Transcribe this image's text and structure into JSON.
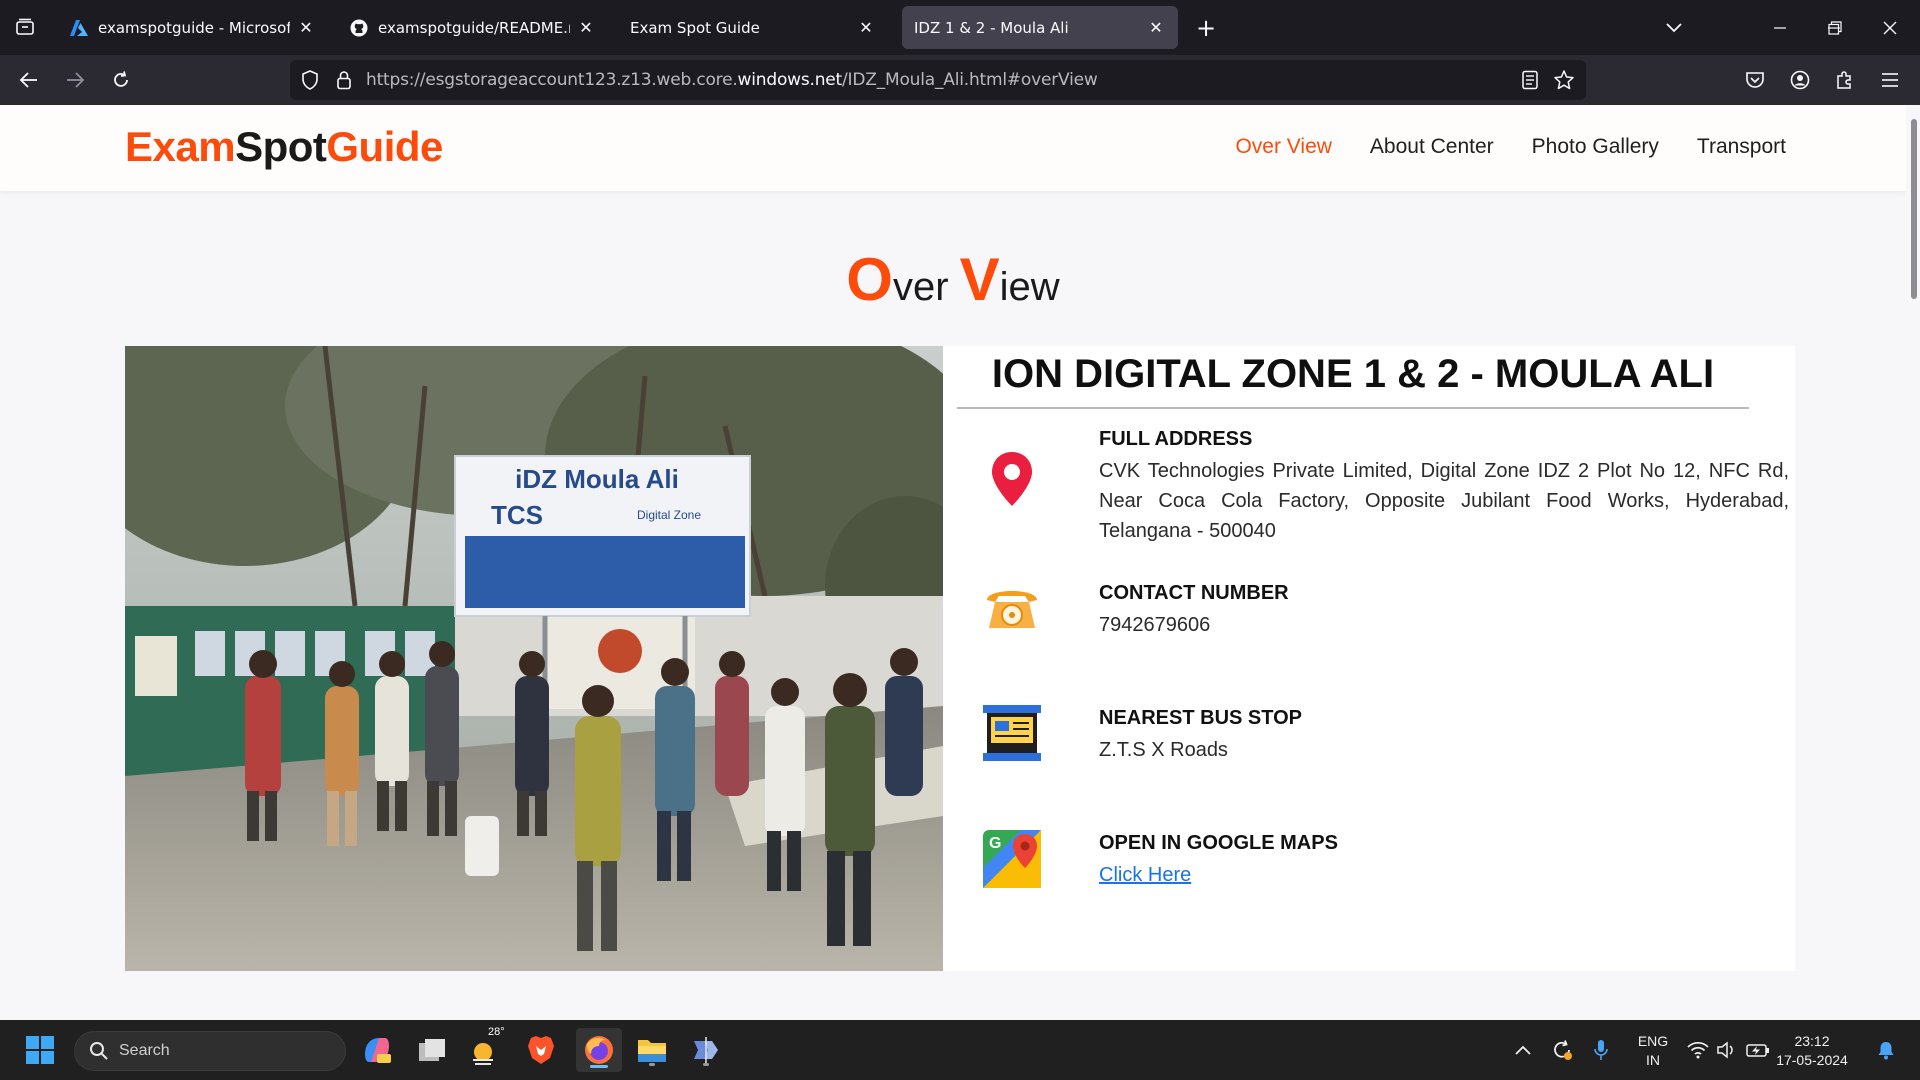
{
  "browser": {
    "tabs": [
      {
        "title": "examspotguide - Microsoft Azu",
        "favicon": "azure-icon",
        "active": false
      },
      {
        "title": "examspotguide/README.md at",
        "favicon": "github-icon",
        "active": false
      },
      {
        "title": "Exam Spot Guide",
        "favicon": "",
        "active": false
      },
      {
        "title": "IDZ 1 & 2 - Moula Ali",
        "favicon": "",
        "active": true
      }
    ],
    "url_prefix": "https://esgstorageaccount123.z13.web.core.",
    "url_host": "windows.net",
    "url_path": "/IDZ_Moula_Ali.html#overView"
  },
  "site": {
    "logo_part1": "Exam",
    "logo_part2": "Spot",
    "logo_part3": "Guide",
    "menu": [
      {
        "label": "Over View",
        "active": true
      },
      {
        "label": "About Center",
        "active": false
      },
      {
        "label": "Photo Gallery",
        "active": false
      },
      {
        "label": "Transport",
        "active": false
      }
    ],
    "section_title": {
      "o": "O",
      "ver": "ver ",
      "v": "V",
      "iew": "iew"
    },
    "center_name": "ION DIGITAL ZONE 1 & 2 - MOULA ALI",
    "photo": {
      "sign_title": "iDZ Moula Ali",
      "sign_brand": "TCS",
      "sign_sub": "Digital Zone"
    },
    "info": [
      {
        "label": "FULL ADDRESS",
        "value": "CVK Technologies Private Limited, Digital Zone IDZ 2 Plot No 12, NFC Rd, Near Coca Cola Factory, Opposite Jubilant Food Works, Hyderabad, Telangana - 500040",
        "icon": "location-pin-icon"
      },
      {
        "label": "CONTACT NUMBER",
        "value": "7942679606",
        "icon": "telephone-icon"
      },
      {
        "label": "NEAREST BUS STOP",
        "value": "Z.T.S X Roads",
        "icon": "bus-stop-icon"
      },
      {
        "label": "OPEN IN GOOGLE MAPS",
        "value": "Click Here",
        "icon": "google-maps-icon"
      }
    ],
    "colors": {
      "accent": "#fd4b0b"
    }
  },
  "taskbar": {
    "search_label": "Search",
    "weather_temp": "28°",
    "lang_line1": "ENG",
    "lang_line2": "IN",
    "time": "23:12",
    "date": "17-05-2024"
  }
}
